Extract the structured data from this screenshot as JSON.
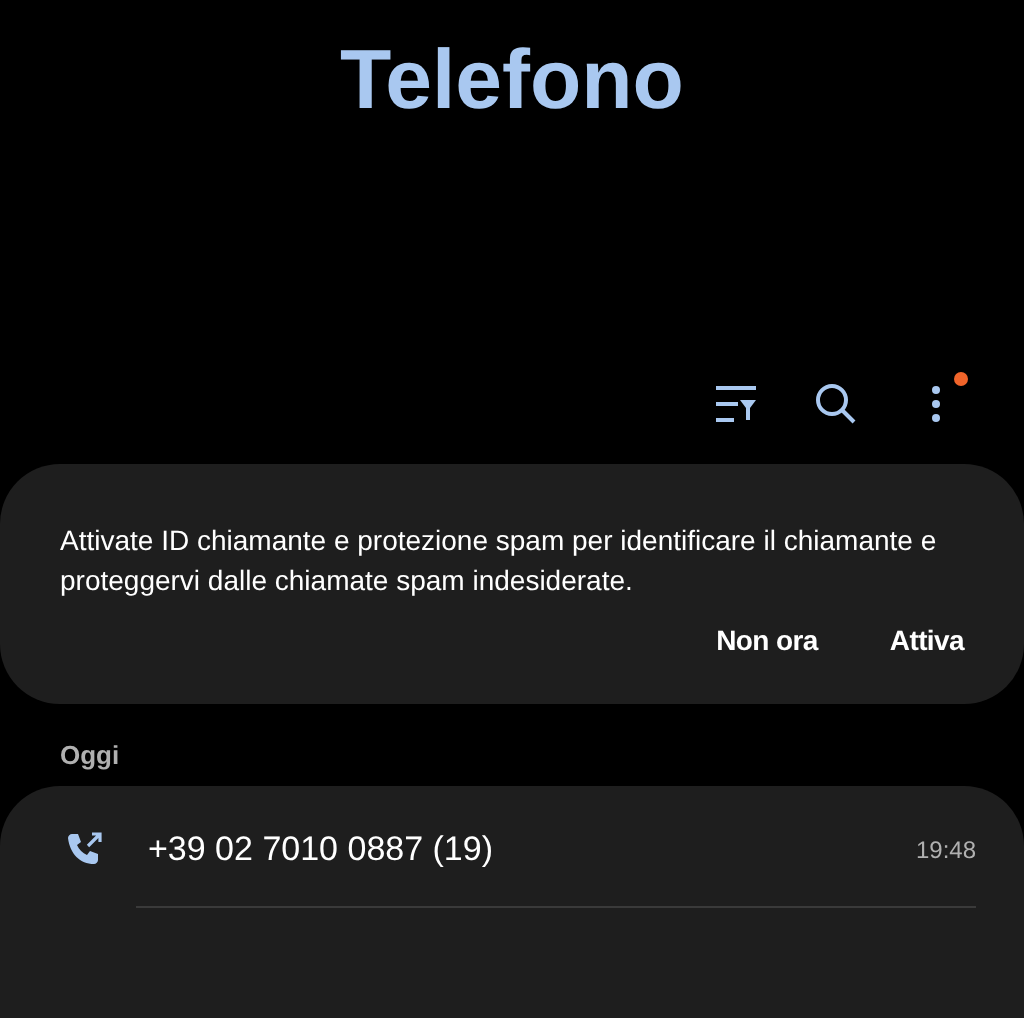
{
  "app_title": "Telefono",
  "toolbar": [
    {
      "kind": "filter"
    },
    {
      "kind": "search"
    },
    {
      "kind": "more",
      "notification": true
    }
  ],
  "banner": {
    "message": "Attivate ID chiamante e protezione spam per identificare il chiamante e proteggervi dalle chiamate spam indesiderate.",
    "actions": [
      "Non ora",
      "Attiva"
    ]
  },
  "section": "Oggi",
  "calls": [
    {
      "kind": "outgoing",
      "number": "+39 02 7010 0887 (19)",
      "time": "19:48"
    }
  ]
}
